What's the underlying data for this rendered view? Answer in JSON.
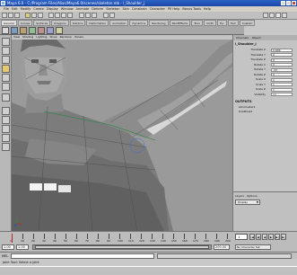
{
  "window": {
    "title": "Maya 6.0 - C:/Program Files/Alias/Maya6.0/scenes/skeleton.mb - l_Shoulder_j"
  },
  "menubar": [
    "File",
    "Edit",
    "Modify",
    "Create",
    "Display",
    "Window",
    "Animate",
    "Deform",
    "Skeleton",
    "Skin",
    "Constrain",
    "Character",
    "PE Help",
    "Bonus Tools",
    "Help"
  ],
  "shelf_tabs": [
    "General",
    "Curves",
    "Surfaces",
    "Polygons",
    "Subdivs",
    "Deformation",
    "Animation",
    "Dynamics",
    "Rendering",
    "PaintEffects",
    "Toon",
    "Cloth",
    "Fur",
    "Hair",
    "Custom"
  ],
  "shelf_active_index": 0,
  "panel_menu": [
    "View",
    "Shading",
    "Lighting",
    "Show",
    "Renderer",
    "Panels"
  ],
  "channel_box": {
    "tabs": [
      "Channels",
      "Object"
    ],
    "object_name": "l_Shoulder_j",
    "attributes": [
      {
        "label": "Translate X",
        "value": "0.666"
      },
      {
        "label": "Translate Y",
        "value": "0"
      },
      {
        "label": "Translate Z",
        "value": "0"
      },
      {
        "label": "Rotate X",
        "value": "0"
      },
      {
        "label": "Rotate Y",
        "value": "-43"
      },
      {
        "label": "Rotate Z",
        "value": "0"
      },
      {
        "label": "Scale X",
        "value": "1"
      },
      {
        "label": "Scale Y",
        "value": "1"
      },
      {
        "label": "Scale Z",
        "value": "1"
      },
      {
        "label": "Visibility",
        "value": "on"
      }
    ],
    "outputs_label": "OUTPUTS",
    "outputs": [
      "skinCluster1",
      "bindPose1"
    ]
  },
  "layer_editor": {
    "menu": [
      "Layers",
      "Options"
    ],
    "dropdown_value": "Display"
  },
  "time_slider": {
    "tick_labels": [
      "1",
      "10",
      "20",
      "30",
      "40",
      "50",
      "60",
      "70",
      "80",
      "90",
      "100",
      "110",
      "120",
      "130",
      "140",
      "150",
      "160",
      "170",
      "180",
      "190",
      "200"
    ],
    "current_frame": "1",
    "playback_buttons": [
      "|◀",
      "◀|",
      "◀",
      "▶",
      "▶|",
      "▶|"
    ]
  },
  "range_slider": {
    "start": "1.00",
    "inner_start": "1.00",
    "inner_end": "200.00",
    "end": "200.00",
    "character_set": "No Character Set"
  },
  "command_line": {
    "label": "MEL"
  },
  "help_line": "Joint Tool: Select a joint"
}
